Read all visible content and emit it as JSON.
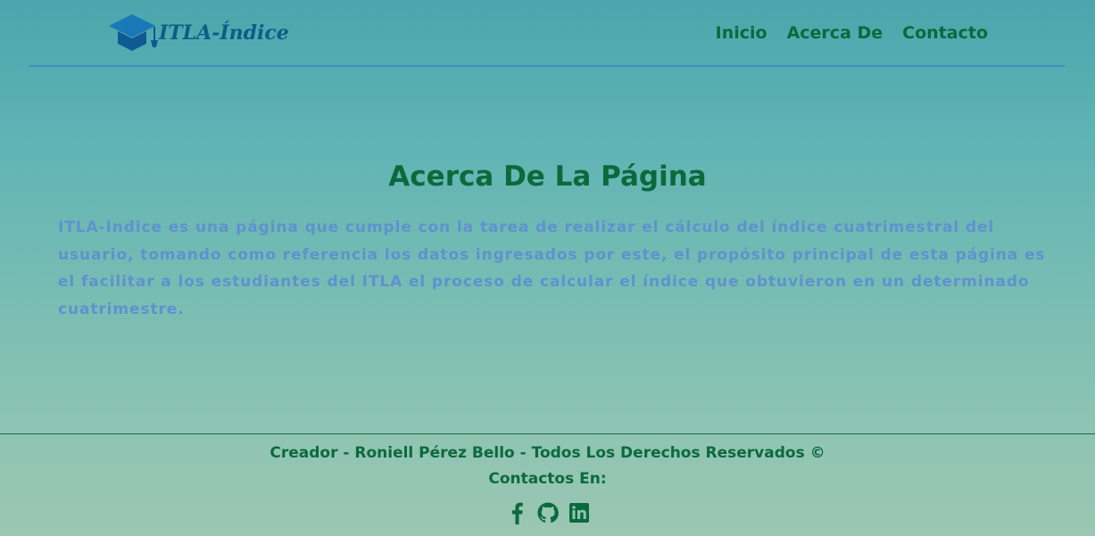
{
  "header": {
    "logo_text": "ITLA-Índice",
    "nav": [
      {
        "label": "Inicio"
      },
      {
        "label": "Acerca De"
      },
      {
        "label": "Contacto"
      }
    ]
  },
  "main": {
    "title": "Acerca De La Página",
    "description": "ITLA-Indice es una página que cumple con la tarea de realizar el cálculo del índice cuatrimestral del usuario, tomando como referencia los datos ingresados por este, el propósito principal de esta página es el facilitar a los estudiantes del ITLA el proceso de calcular el índice que obtuvieron en un determinado cuatrimestre."
  },
  "footer": {
    "credit": "Creador - Roniell Pérez Bello - Todos Los Derechos Reservados ©",
    "contacts_label": "Contactos En:",
    "socials": [
      {
        "icon": "facebook-icon"
      },
      {
        "icon": "github-icon"
      },
      {
        "icon": "linkedin-icon"
      }
    ]
  },
  "colors": {
    "accent_green": "#0b6a3c",
    "text_blue": "#5f92cf",
    "logo_blue": "#0e5d86",
    "divider_blue": "#3f86c4"
  }
}
